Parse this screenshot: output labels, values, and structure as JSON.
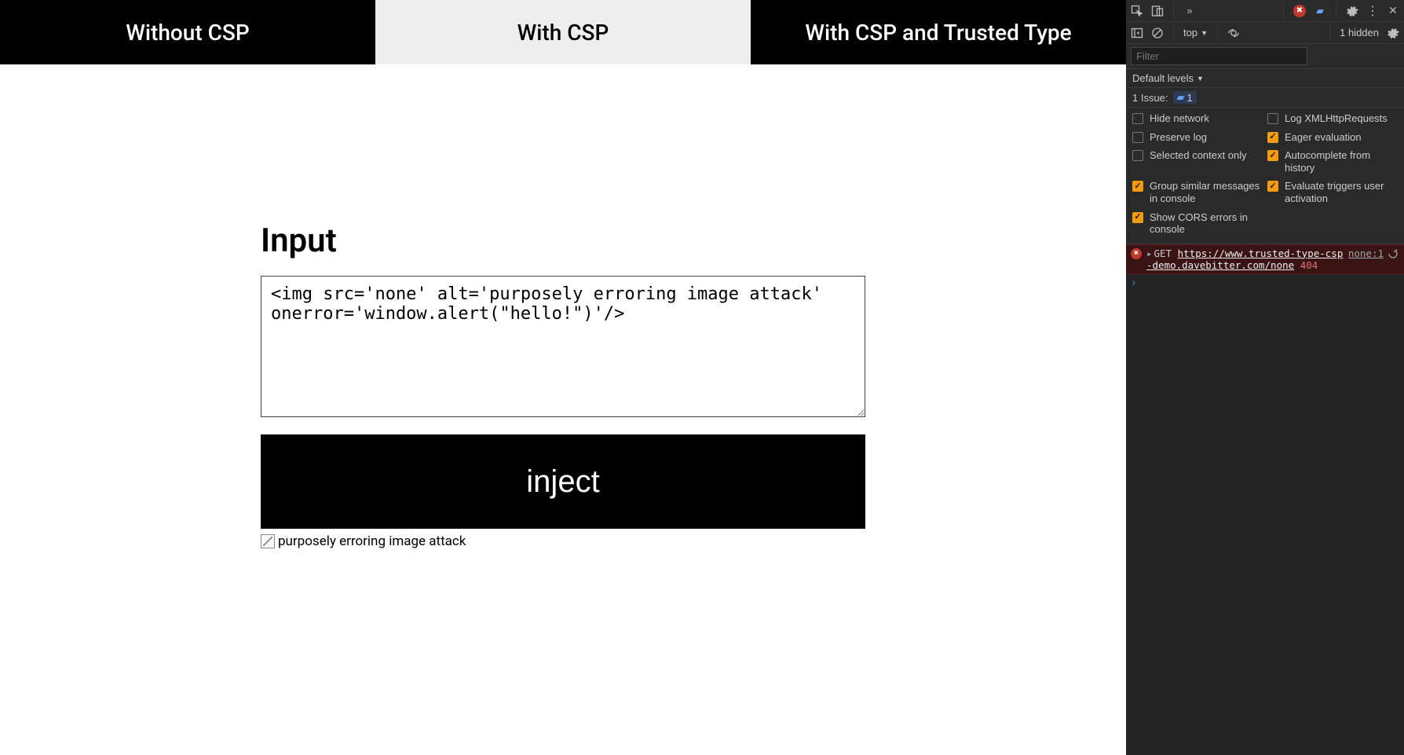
{
  "tabs": {
    "without": "Without CSP",
    "with": "With CSP",
    "trusted": "With CSP and Trusted Type"
  },
  "main": {
    "heading": "Input",
    "textarea_value": "<img src='none' alt='purposely erroring image attack' onerror='window.alert(\"hello!\")'/>",
    "inject_label": "inject",
    "broken_alt": "purposely erroring image attack"
  },
  "devtools": {
    "topbar": {
      "error_count": "",
      "more": "»"
    },
    "row2": {
      "context": "top",
      "hidden": "1 hidden"
    },
    "filter_placeholder": "Filter",
    "levels_label": "Default levels",
    "issues": {
      "label": "1 Issue:",
      "count": "1"
    },
    "settings": {
      "hide_network": "Hide network",
      "log_xhr": "Log XMLHttpRequests",
      "preserve_log": "Preserve log",
      "eager_eval": "Eager evaluation",
      "selected_ctx": "Selected context only",
      "autocomplete": "Autocomplete from history",
      "group_similar": "Group similar messages in console",
      "eval_triggers": "Evaluate triggers user activation",
      "show_cors": "Show CORS errors in console"
    },
    "error": {
      "method": "GET",
      "url": "https://www.trusted-type-csp-demo.davebitter.com/none",
      "status": "404",
      "source": "none:1"
    },
    "prompt": "›"
  }
}
